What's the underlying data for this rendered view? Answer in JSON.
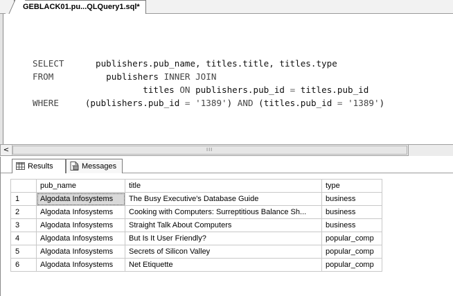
{
  "document_tab": {
    "title": "GEBLACK01.pu...QLQuery1.sql*"
  },
  "editor": {
    "line1": {
      "kw": "SELECT",
      "text": "publishers.pub_name, titles.title, titles.type"
    },
    "line2": {
      "kw": "FROM",
      "text": "publishers",
      "join": "INNER JOIN"
    },
    "line3": {
      "text": "titles",
      "on": "ON",
      "cond_left": "publishers.pub_id",
      "eq": "=",
      "cond_right": "titles.pub_id"
    },
    "line4": {
      "kw": "WHERE",
      "open1": "(publishers.pub_id",
      "eq1": "=",
      "val1": "'1389'",
      "close1": ")",
      "and": "AND",
      "open2": "(titles.pub_id",
      "eq2": "=",
      "val2": "'1389'",
      "close2": ")"
    }
  },
  "scrollbar": {
    "left_arrow": "<",
    "grip": "III"
  },
  "results_tabs": {
    "results": "Results",
    "messages": "Messages"
  },
  "grid": {
    "columns": [
      "pub_name",
      "title",
      "type"
    ],
    "rows": [
      {
        "num": "1",
        "pub_name": "Algodata Infosystems",
        "title": "The Busy Executive's Database Guide",
        "type": "business"
      },
      {
        "num": "2",
        "pub_name": "Algodata Infosystems",
        "title": "Cooking with Computers: Surreptitious Balance Sh...",
        "type": "business"
      },
      {
        "num": "3",
        "pub_name": "Algodata Infosystems",
        "title": "Straight Talk About Computers",
        "type": "business"
      },
      {
        "num": "4",
        "pub_name": "Algodata Infosystems",
        "title": "But Is It User Friendly?",
        "type": "popular_comp"
      },
      {
        "num": "5",
        "pub_name": "Algodata Infosystems",
        "title": "Secrets of Silicon Valley",
        "type": "popular_comp"
      },
      {
        "num": "6",
        "pub_name": "Algodata Infosystems",
        "title": "Net Etiquette",
        "type": "popular_comp"
      }
    ]
  }
}
